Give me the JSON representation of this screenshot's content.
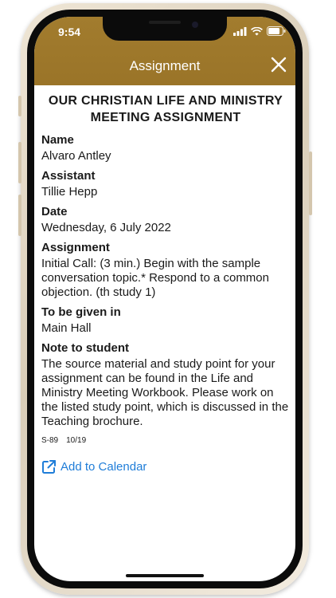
{
  "status_bar": {
    "time": "9:54"
  },
  "header": {
    "title": "Assignment",
    "close_icon": "close-icon"
  },
  "form": {
    "heading_line1": "OUR CHRISTIAN LIFE AND MINISTRY",
    "heading_line2": "MEETING ASSIGNMENT",
    "fields": [
      {
        "label": "Name",
        "value": "Alvaro Antley"
      },
      {
        "label": "Assistant",
        "value": "Tillie Hepp"
      },
      {
        "label": "Date",
        "value": "Wednesday, 6 July 2022"
      },
      {
        "label": "Assignment",
        "value": "Initial Call: (3 min.) Begin with the sample conversation topic.* Respond to a common objection. (th study 1)"
      },
      {
        "label": "To be given in",
        "value": "Main Hall"
      },
      {
        "label": "Note to student",
        "value": "The source material and study point for your assignment can be found in the Life and Ministry Meeting Workbook. Please work on the listed study point, which is discussed in the Teaching brochure."
      }
    ],
    "form_code": "S-89",
    "form_date": "10/19"
  },
  "calendar": {
    "label": "Add to Calendar",
    "icon": "external-link-icon"
  },
  "colors": {
    "header": "#9e782b",
    "link": "#1f7dd8"
  }
}
